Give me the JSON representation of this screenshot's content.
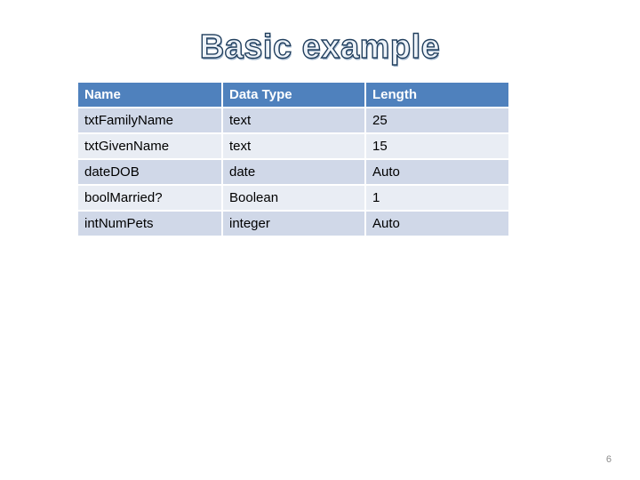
{
  "slide": {
    "title": "Basic example",
    "page_number": "6"
  },
  "table": {
    "headers": [
      "Name",
      "Data Type",
      "Length"
    ],
    "rows": [
      [
        "txtFamilyName",
        "text",
        "25"
      ],
      [
        "txtGivenName",
        "text",
        "15"
      ],
      [
        "dateDOB",
        "date",
        "Auto"
      ],
      [
        "boolMarried?",
        "Boolean",
        "1"
      ],
      [
        "intNumPets",
        "integer",
        "Auto"
      ]
    ]
  },
  "colors": {
    "header_bg": "#4f81bd",
    "row_odd_bg": "#d0d8e8",
    "row_even_bg": "#e9edf4"
  }
}
